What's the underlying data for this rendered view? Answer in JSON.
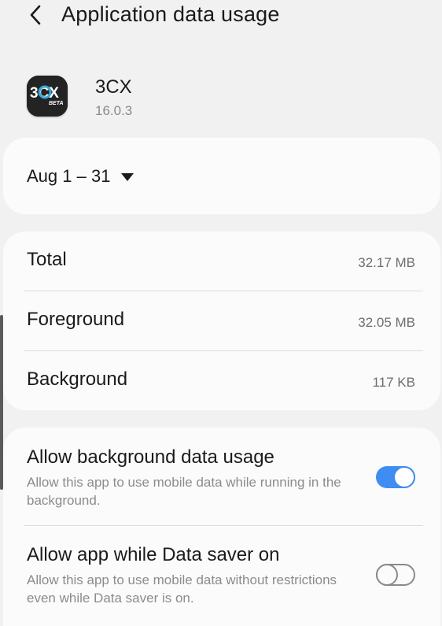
{
  "header": {
    "title": "Application data usage",
    "back_icon": "back-arrow-icon"
  },
  "app": {
    "name": "3CX",
    "version": "16.0.3",
    "icon_text": "3CX",
    "icon_badge": "BETA",
    "icon_accent": "#3aa8d8"
  },
  "date_range": {
    "label": "Aug 1 – 31",
    "icon": "dropdown-triangle-icon"
  },
  "usage": {
    "total": {
      "label": "Total",
      "value": "32.17 MB"
    },
    "foreground": {
      "label": "Foreground",
      "value": "32.05 MB"
    },
    "background": {
      "label": "Background",
      "value": "117 KB"
    }
  },
  "settings": [
    {
      "title": "Allow background data usage",
      "description": "Allow this app to use mobile data while running in the background.",
      "enabled": true
    },
    {
      "title": "Allow app while Data saver on",
      "description": "Allow this app to use mobile data without restrictions even while Data saver is on.",
      "enabled": false
    }
  ],
  "colors": {
    "accent": "#3f8cf2",
    "background": "#f1f1f1",
    "card": "#fbfbfb"
  }
}
